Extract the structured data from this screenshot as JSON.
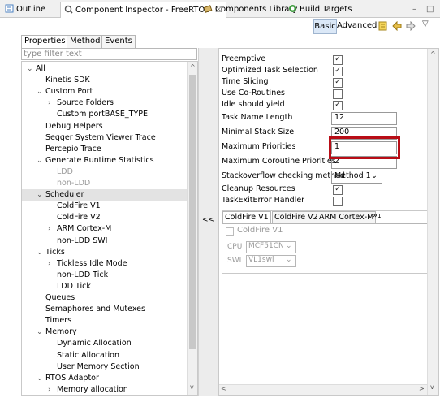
{
  "tabs": [
    {
      "label": "Outline"
    },
    {
      "label": "Component Inspector - FreeRTOS",
      "close": "☒"
    },
    {
      "label": "Components Library"
    },
    {
      "label": "Build Targets"
    }
  ],
  "window_controls": {
    "minimize": "–",
    "maximize": "□"
  },
  "toolbar": {
    "basic": "Basic",
    "advanced": "Advanced",
    "menu_glyph": "▽"
  },
  "subtabs": [
    "Properties",
    "Methods",
    "Events"
  ],
  "filter": {
    "placeholder": "type filter text"
  },
  "tree": [
    {
      "label": "All",
      "level": 0,
      "arrow": "v"
    },
    {
      "label": "Kinetis SDK",
      "level": 1
    },
    {
      "label": "Custom Port",
      "level": 1,
      "arrow": "v"
    },
    {
      "label": "Source Folders",
      "level": 2,
      "arrow": ">"
    },
    {
      "label": "Custom portBASE_TYPE",
      "level": 2
    },
    {
      "label": "Debug Helpers",
      "level": 1
    },
    {
      "label": "Segger System Viewer Trace",
      "level": 1
    },
    {
      "label": "Percepio Trace",
      "level": 1
    },
    {
      "label": "Generate Runtime Statistics",
      "level": 1,
      "arrow": "v"
    },
    {
      "label": "LDD",
      "level": 2,
      "disabled": true
    },
    {
      "label": "non-LDD",
      "level": 2,
      "disabled": true
    },
    {
      "label": "Scheduler",
      "level": 1,
      "arrow": "v",
      "selected": true
    },
    {
      "label": "ColdFire V1",
      "level": 2
    },
    {
      "label": "ColdFire V2",
      "level": 2
    },
    {
      "label": "ARM Cortex-M",
      "level": 2,
      "arrow": ">"
    },
    {
      "label": "non-LDD SWI",
      "level": 2
    },
    {
      "label": "Ticks",
      "level": 1,
      "arrow": "v"
    },
    {
      "label": "Tickless Idle Mode",
      "level": 2,
      "arrow": ">"
    },
    {
      "label": "non-LDD Tick",
      "level": 2
    },
    {
      "label": "LDD Tick",
      "level": 2
    },
    {
      "label": "Queues",
      "level": 1
    },
    {
      "label": "Semaphores and Mutexes",
      "level": 1
    },
    {
      "label": "Timers",
      "level": 1
    },
    {
      "label": "Memory",
      "level": 1,
      "arrow": "v"
    },
    {
      "label": "Dynamic Allocation",
      "level": 2
    },
    {
      "label": "Static Allocation",
      "level": 2
    },
    {
      "label": "User Memory Section",
      "level": 2
    },
    {
      "label": "RTOS Adaptor",
      "level": 1,
      "arrow": "v"
    },
    {
      "label": "Memory allocation",
      "level": 2,
      "arrow": ">"
    }
  ],
  "collapse_button": "<<",
  "properties": [
    {
      "label": "Preemptive",
      "type": "check",
      "checked": true
    },
    {
      "label": "Optimized Task Selection",
      "type": "check",
      "checked": true
    },
    {
      "label": "Time Slicing",
      "type": "check",
      "checked": true
    },
    {
      "label": "Use Co-Routines",
      "type": "check",
      "checked": false
    },
    {
      "label": "Idle should yield",
      "type": "check",
      "checked": true
    },
    {
      "label": "Task Name Length",
      "type": "text",
      "value": "12"
    },
    {
      "label": "Minimal Stack Size",
      "type": "text",
      "value": "200"
    },
    {
      "label": "Maximum Priorities",
      "type": "text",
      "value": "1",
      "highlight": true
    },
    {
      "label": "Maximum Coroutine Priorities",
      "type": "text",
      "value": "2"
    },
    {
      "label": "Stackoverflow checking method",
      "type": "combo",
      "value": "Method 1"
    },
    {
      "label": "Cleanup Resources",
      "type": "check",
      "checked": true
    },
    {
      "label": "TaskExitError Handler",
      "type": "check",
      "checked": false
    }
  ],
  "inner_tabs": [
    "ColdFire V1",
    "ColdFire V2",
    "ARM Cortex-M"
  ],
  "inner_more": "»",
  "inner_more_count": "1",
  "inner_panel": {
    "checkbox_label": "ColdFire V1",
    "cpu_label": "CPU",
    "cpu_value": "MCF51CN",
    "swi_label": "SWI",
    "swi_value": "VL1swi"
  }
}
